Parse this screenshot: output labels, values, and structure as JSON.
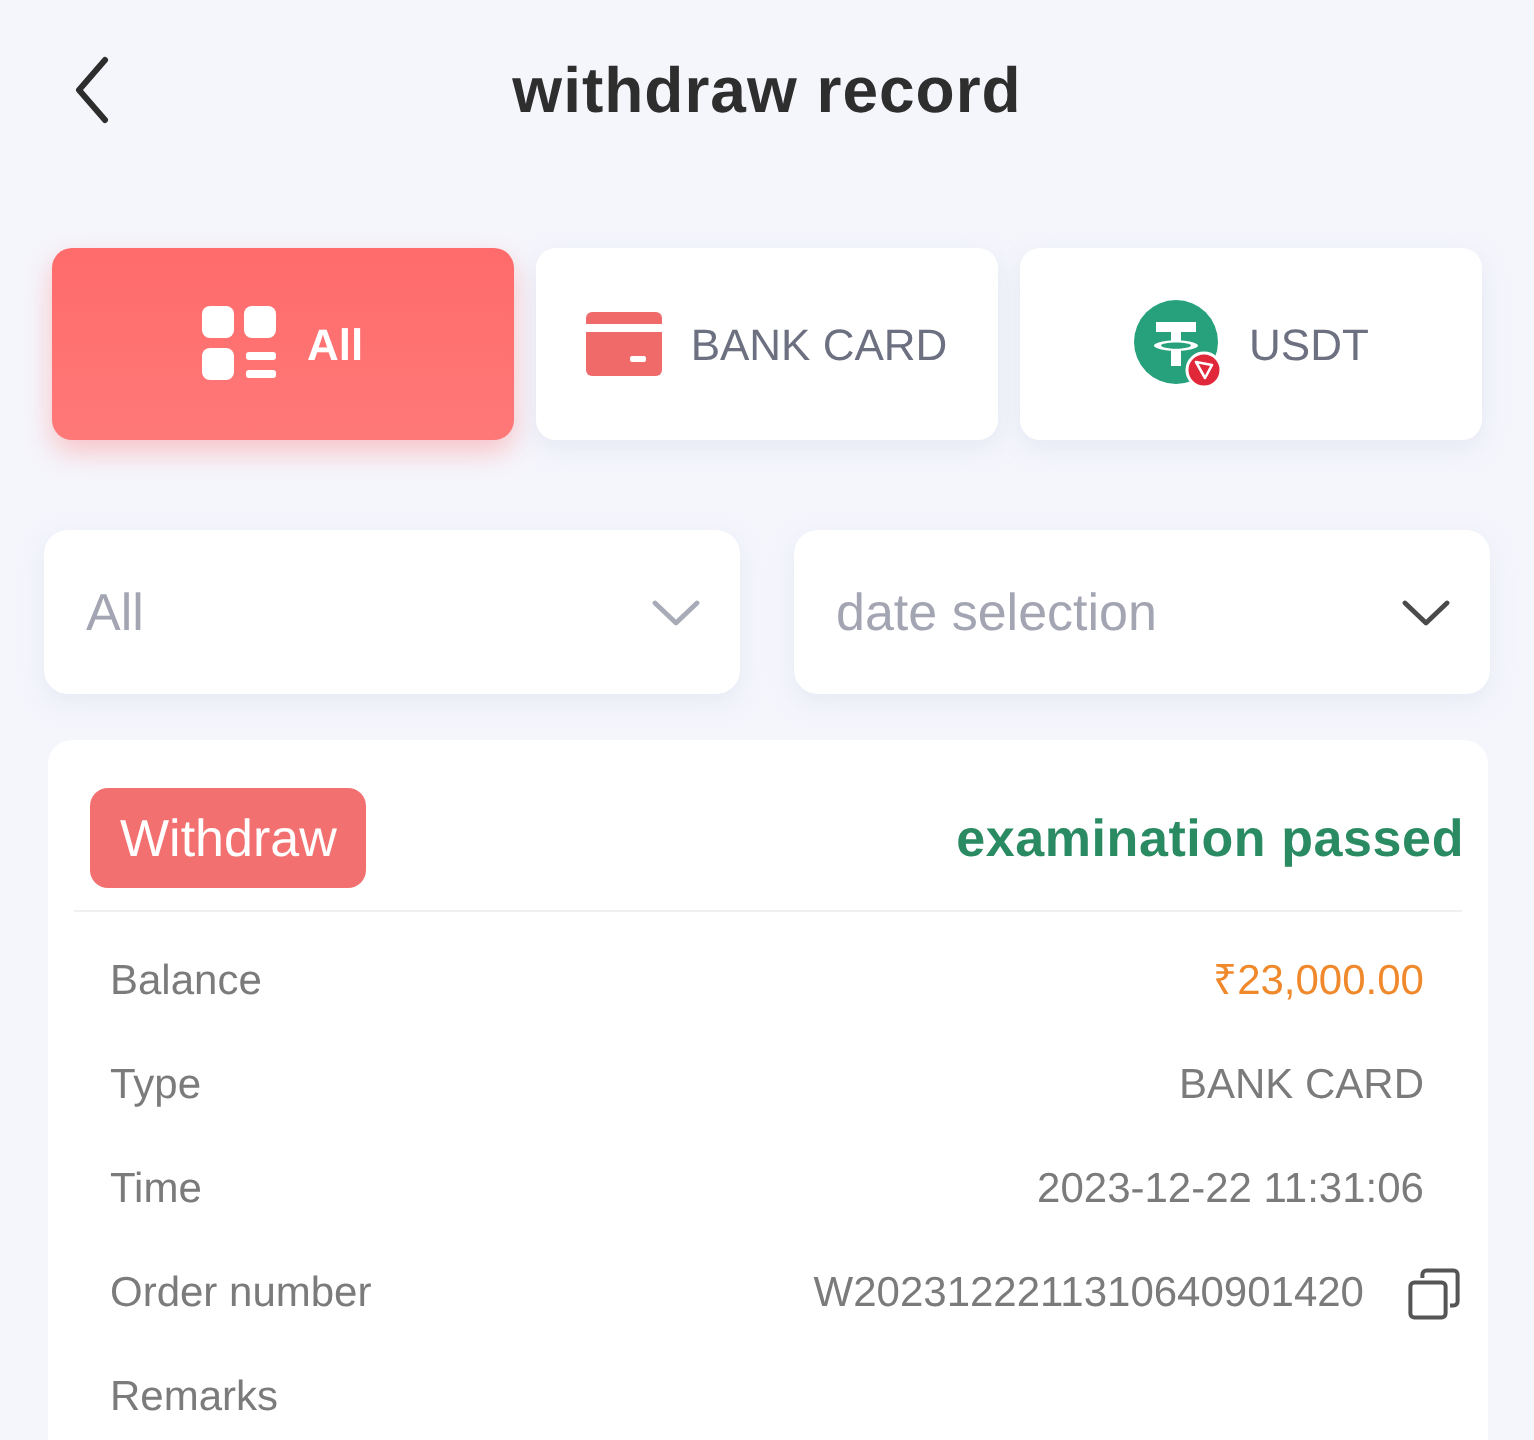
{
  "header": {
    "title": "withdraw record"
  },
  "tabs": [
    {
      "label": "All",
      "kind": "all",
      "selected": true
    },
    {
      "label": "BANK CARD",
      "kind": "bank",
      "selected": false
    },
    {
      "label": "USDT",
      "kind": "usdt",
      "selected": false
    }
  ],
  "filters": [
    {
      "value": "All"
    },
    {
      "placeholder": "date selection"
    }
  ],
  "record": {
    "badge": "Withdraw",
    "status": "examination passed",
    "fields": [
      {
        "label": "Balance",
        "value": "₹23,000.00",
        "kind": "amount"
      },
      {
        "label": "Type",
        "value": "BANK CARD",
        "kind": "text"
      },
      {
        "label": "Time",
        "value": "2023-12-22 11:31:06",
        "kind": "text"
      },
      {
        "label": "Order number",
        "value": "W2023122211310640901420",
        "kind": "copyable"
      },
      {
        "label": "Remarks"
      }
    ]
  }
}
